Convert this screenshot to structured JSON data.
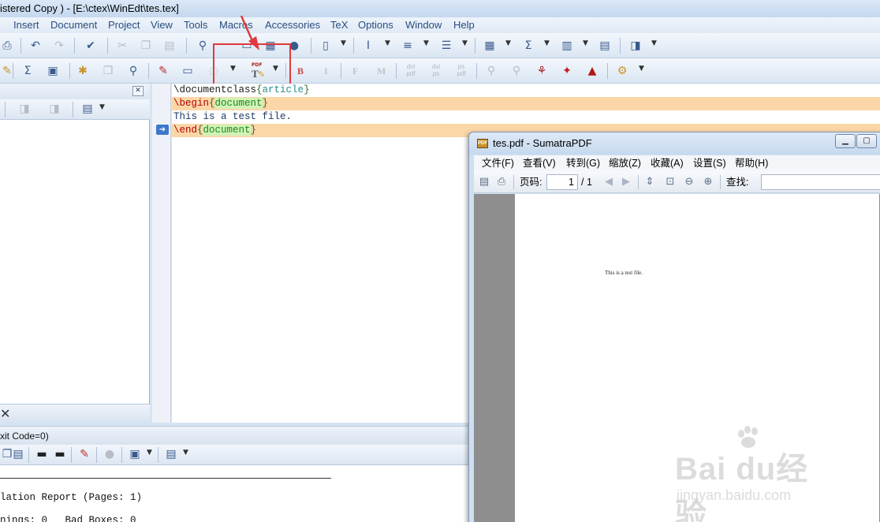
{
  "winedt": {
    "title": "istered  Copy ) - [E:\\ctex\\WinEdt\\tes.tex]",
    "menu": [
      "Insert",
      "Document",
      "Project",
      "View",
      "Tools",
      "Macros",
      "Accessories",
      "TeX",
      "Options",
      "Window",
      "Help"
    ],
    "toolbar2_labels": {
      "bold": "B",
      "italic": "I",
      "font_f": "F",
      "font_m": "M",
      "dvi_pdf": "dvi pdf",
      "dvi_ps": "dvi ps",
      "ps_pdf": "ps pdf",
      "pdftex_icon_text": "PDF"
    },
    "editor_lines": [
      {
        "cmd": "\\documentclass",
        "open": "{",
        "arg": "article",
        "close": "}",
        "highlight": false
      },
      {
        "cmd": "\\begin",
        "open": "{",
        "arg": "document",
        "close": "}",
        "highlight": true
      },
      {
        "text": "This is a test file.",
        "highlight": false
      },
      {
        "cmd": "\\end",
        "open": "{",
        "arg": "document",
        "close": "}",
        "highlight": true
      }
    ],
    "bottom_panel": {
      "header": "xit Code=0)",
      "lines": [
        "lation Report (Pages: 1)",
        "nings: 0   Bad Boxes: 0"
      ]
    }
  },
  "sumatra": {
    "title": "tes.pdf - SumatraPDF",
    "title_icon_text": "PDF",
    "menu": [
      "文件(F)",
      "查看(V)",
      "转到(G)",
      "缩放(Z)",
      "收藏(A)",
      "设置(S)",
      "帮助(H)"
    ],
    "page_label": "页码:",
    "page_value": "1",
    "page_total": "/ 1",
    "find_label": "查找:",
    "find_value": "",
    "document_text": "This is a test file."
  },
  "watermark": {
    "logo": "Bai  du经验",
    "url": "jingyan.baidu.com"
  },
  "colors": {
    "highlight_box": "#e0393e",
    "line_highlight": "#fbd7a8",
    "chrome_blue": "#d6e3f2"
  }
}
